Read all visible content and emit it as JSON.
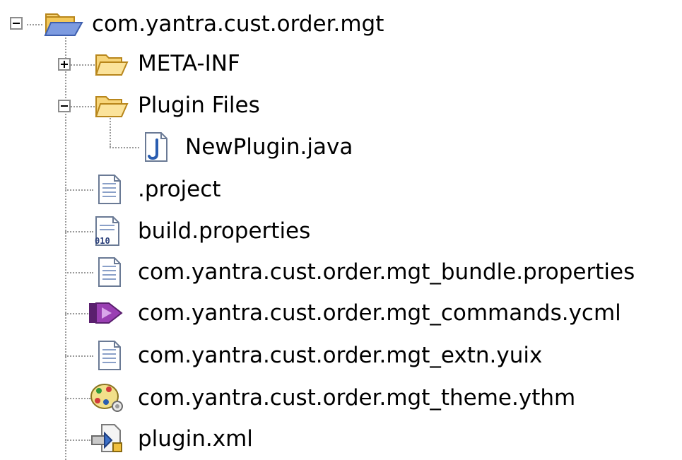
{
  "tree": {
    "root": {
      "label": "com.yantra.cust.order.mgt",
      "expanded": true,
      "icon": "folder-open-icon"
    },
    "items": [
      {
        "label": "META-INF",
        "icon": "folder-icon",
        "expandable": true,
        "expanded": false
      },
      {
        "label": "Plugin Files",
        "icon": "folder-open-icon",
        "expandable": true,
        "expanded": true,
        "children": [
          {
            "label": "NewPlugin.java",
            "icon": "java-file-icon"
          }
        ]
      },
      {
        "label": ".project",
        "icon": "text-file-icon"
      },
      {
        "label": "build.properties",
        "icon": "properties-file-icon"
      },
      {
        "label": "com.yantra.cust.order.mgt_bundle.properties",
        "icon": "text-file-icon"
      },
      {
        "label": "com.yantra.cust.order.mgt_commands.ycml",
        "icon": "commands-file-icon"
      },
      {
        "label": "com.yantra.cust.order.mgt_extn.yuix",
        "icon": "text-file-icon"
      },
      {
        "label": "com.yantra.cust.order.mgt_theme.ythm",
        "icon": "theme-palette-icon"
      },
      {
        "label": "plugin.xml",
        "icon": "plugin-xml-icon"
      }
    ]
  },
  "colors": {
    "folder_fill": "#f7d57a",
    "folder_stroke": "#b8861b",
    "folder_open_blue": "#6f8fd9",
    "java_blue": "#2a5db0",
    "commands_purple": "#7a2f8f",
    "connector": "#9a9a9a"
  }
}
